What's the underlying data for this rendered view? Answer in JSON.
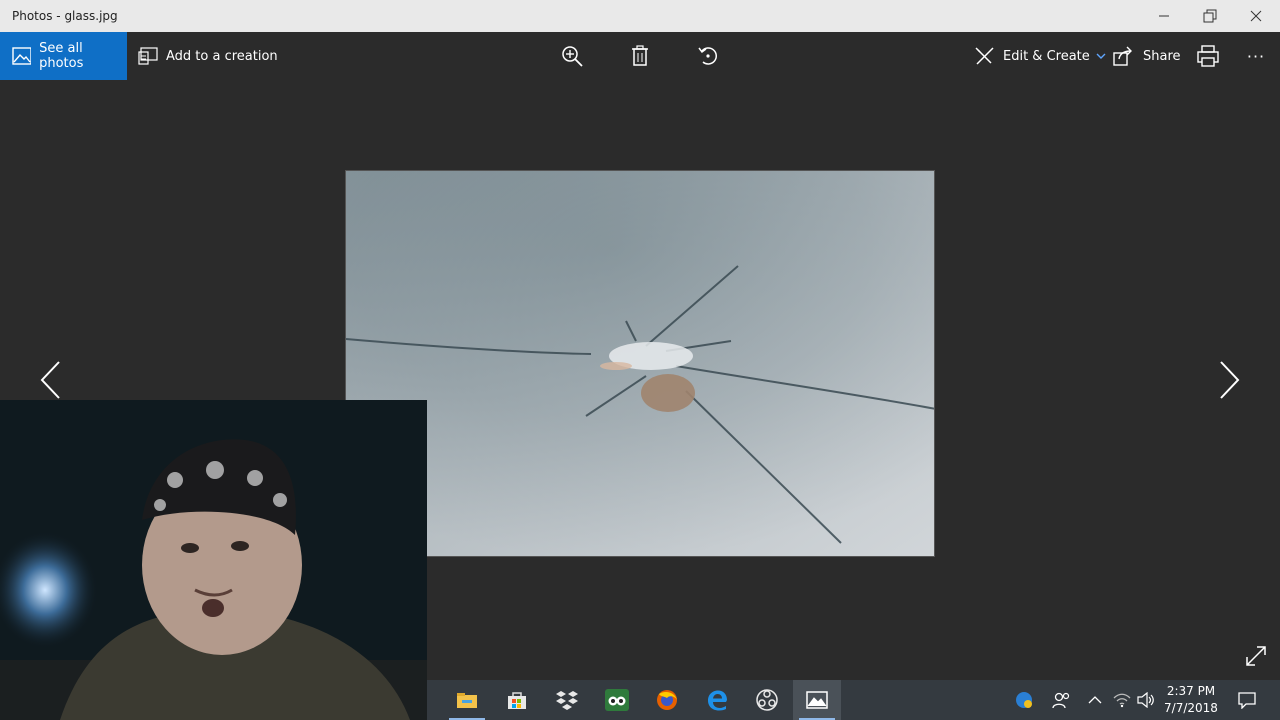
{
  "window": {
    "title": "Photos - glass.jpg"
  },
  "toolbar": {
    "see_all_label": "See all photos",
    "add_creation_label": "Add to a creation",
    "edit_create_label": "Edit & Create",
    "share_label": "Share",
    "more_label": "···"
  },
  "clock": {
    "time": "2:37 PM",
    "date": "7/7/2018"
  },
  "colors": {
    "accent": "#0f6fc6",
    "titlebar": "#e9e9e9",
    "background": "#2b2b2b",
    "taskbar": "#343a40"
  },
  "taskbar": {
    "apps": [
      "file-explorer-icon",
      "store-icon",
      "dropbox-icon",
      "tripadvisor-icon",
      "firefox-icon",
      "edge-icon",
      "obs-icon",
      "photos-icon"
    ]
  }
}
